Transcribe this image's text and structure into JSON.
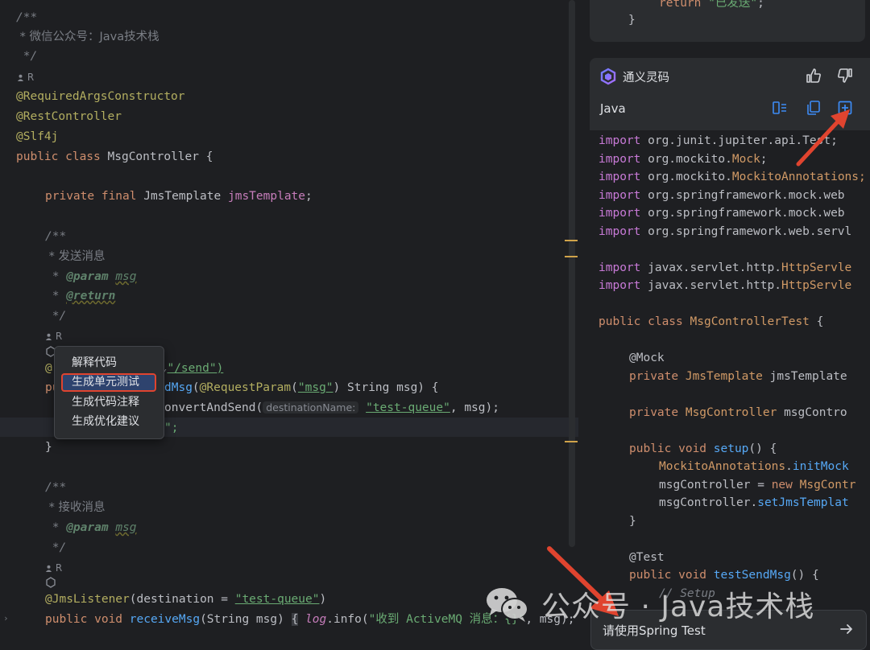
{
  "editor": {
    "lines": {
      "l1": "/**",
      "l2": " * 微信公众号：Java技术栈",
      "l3": " */",
      "author": "R",
      "ann_required": "@RequiredArgsConstructor",
      "ann_rest": "@RestController",
      "ann_slf": "@Slf4j",
      "class_kw": "public class ",
      "class_name": "MsgController {",
      "field_kw": "private final ",
      "field_type": "JmsTemplate ",
      "field_name": "jmsTemplate",
      "semi": ";",
      "doc_open": "/**",
      "doc_send": " * 发送消息",
      "doc_star": " * ",
      "doc_param": "@param",
      "doc_msg": "msg",
      "doc_return": "@return",
      "doc_close": " */",
      "author2": "R",
      "mapping_frag": "@",
      "mapping_tail": "\"/send\")",
      "mapping_prefix": "@",
      "send_sig_prefix": "pu",
      "send_sig_name": "dMsg",
      "send_sig_rest1": "(",
      "send_sig_ann": "@RequestParam",
      "send_sig_rest2": "(",
      "send_sig_str": "\"msg\"",
      "send_sig_rest3": ") String msg) {",
      "convert_call": "onvertAndSend(",
      "hint_dest": "destinationName:",
      "convert_str": "\"test-queue\"",
      "convert_rest": ", msg);",
      "return_tail": "\";",
      "close_brace": "}",
      "doc2_open": "/**",
      "doc2_recv": " * 接收消息",
      "doc2_star": " * ",
      "doc2_param": "@param",
      "doc2_msg": "msg",
      "doc2_close": " */",
      "author3": "R",
      "listener_ann": "@JmsListener",
      "listener_rest1": "(destination = ",
      "listener_str": "\"test-queue\"",
      "listener_rest2": ")",
      "recv_kw": "public void ",
      "recv_name": "receiveMsg",
      "recv_rest": "(String msg) ",
      "recv_brace": "{",
      "recv_log": " log",
      "recv_info": ".info(",
      "recv_str": "\"收到 ActiveMQ 消息：{}\"",
      "recv_end": ", msg);"
    }
  },
  "context_menu": {
    "items": [
      "解释代码",
      "生成单元测试",
      "生成代码注释",
      "生成优化建议"
    ],
    "selected_index": 1
  },
  "assistant": {
    "prev_message": {
      "return_kw": "return ",
      "return_str": "\"已发送\"",
      "return_end": ";",
      "brace": "}"
    },
    "brand": "通义灵码",
    "language": "Java",
    "code_lines": {
      "c1a": "import ",
      "c1b": "org.junit.jupiter.api.Test;",
      "c2a": "import ",
      "c2b": "org.mockito.",
      "c2c": "Mock",
      "c2d": ";",
      "c3a": "import ",
      "c3b": "org.mockito.",
      "c3c": "MockitoAnnotations;",
      "c4a": "import ",
      "c4b": "org.springframework.mock.web",
      "c5a": "import ",
      "c5b": "org.springframework.mock.web",
      "c6a": "import ",
      "c6b": "org.springframework.web.servl",
      "c7a": "import ",
      "c7b": "javax.servlet.http.",
      "c7c": "HttpServle",
      "c8a": "import ",
      "c8b": "javax.servlet.http.",
      "c8c": "HttpServle",
      "c9a": "public class ",
      "c9b": "MsgControllerTest",
      "c9c": " {",
      "c10": "@Mock",
      "c11a": "private ",
      "c11b": "JmsTemplate ",
      "c11c": "jmsTemplate",
      "c12a": "private ",
      "c12b": "MsgController ",
      "c12c": "msgContro",
      "c13a": "public void ",
      "c13b": "setup",
      "c13c": "() {",
      "c14a": "MockitoAnnotations",
      "c14b": ".",
      "c14c": "initMock",
      "c15a": "msgController = ",
      "c15b": "new ",
      "c15c": "MsgContr",
      "c16a": "msgController.",
      "c16b": "setJmsTemplat",
      "c17": "}",
      "c18": "@Test",
      "c19a": "public void ",
      "c19b": "testSendMsg",
      "c19c": "() {",
      "c20": "// Setup"
    },
    "input_text": "请使用Spring Test"
  },
  "watermark": {
    "text": "公众号 · Java技术栈"
  },
  "colors": {
    "editor_bg": "#1e1f22",
    "panel_bg": "#2b2d30",
    "accent_blue": "#3d8bf5",
    "arrow_red": "#e0442f"
  }
}
